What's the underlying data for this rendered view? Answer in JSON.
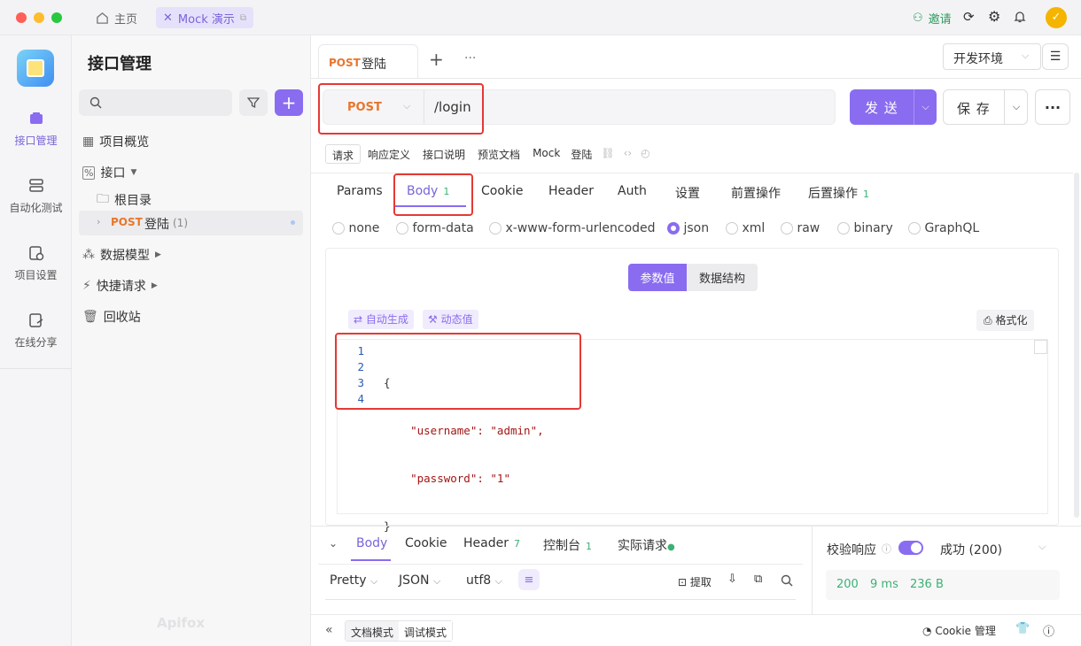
{
  "titlebar": {
    "home_label": "主页",
    "tab_label": "Mock 演示",
    "invite_label": "邀请"
  },
  "leftnav": [
    {
      "label": "接口管理",
      "icon": "api-icon",
      "active": true
    },
    {
      "label": "自动化测试",
      "icon": "automation-icon"
    },
    {
      "label": "项目设置",
      "icon": "settings-icon"
    },
    {
      "label": "在线分享",
      "icon": "share-icon"
    }
  ],
  "sidebar": {
    "title": "接口管理",
    "overview": "项目概览",
    "interfaces": "接口",
    "root": "根目录",
    "item_method": "POST",
    "item_name": "登陆",
    "item_count": "(1)",
    "models": "数据模型",
    "quick": "快捷请求",
    "trash": "回收站"
  },
  "tabs": {
    "active_method": "POST",
    "active_name": "登陆",
    "add": "+",
    "more": "···"
  },
  "env": {
    "label": "开发环境"
  },
  "request": {
    "method": "POST",
    "url": "/login",
    "send": "发 送",
    "save": "保 存"
  },
  "doc_tabs": [
    "请求",
    "响应定义",
    "接口说明",
    "预览文档",
    "Mock"
  ],
  "doc_name": "登陆",
  "param_tabs": [
    {
      "label": "Params"
    },
    {
      "label": "Body",
      "badge": "1"
    },
    {
      "label": "Cookie"
    },
    {
      "label": "Header"
    },
    {
      "label": "Auth"
    },
    {
      "label": "设置"
    },
    {
      "label": "前置操作"
    },
    {
      "label": "后置操作",
      "badge": "1"
    }
  ],
  "body_types": [
    "none",
    "form-data",
    "x-www-form-urlencoded",
    "json",
    "xml",
    "raw",
    "binary",
    "GraphQL"
  ],
  "body_selected": "json",
  "toggle": {
    "values": "参数值",
    "schema": "数据结构"
  },
  "editor": {
    "auto": "自动生成",
    "dynamic": "动态值",
    "format": "格式化",
    "lines": [
      "1",
      "2",
      "3",
      "4"
    ],
    "code": [
      "{",
      "    \"username\": \"admin\",",
      "    \"password\": \"1\"",
      "}"
    ]
  },
  "response": {
    "tabs": [
      {
        "label": "Body"
      },
      {
        "label": "Cookie"
      },
      {
        "label": "Header",
        "badge": "7"
      },
      {
        "label": "控制台",
        "badge": "1"
      },
      {
        "label": "实际请求"
      }
    ],
    "pretty": "Pretty",
    "json": "JSON",
    "encoding": "utf8",
    "extract": "提取"
  },
  "validate": {
    "label": "校验响应",
    "status": "成功 (200)",
    "code": "200",
    "time": "9 ms",
    "size": "236 B"
  },
  "footer": {
    "doc_mode": "文档模式",
    "debug_mode": "调试模式",
    "cookie": "Cookie 管理",
    "watermark": "Apifox"
  },
  "colors": {
    "accent": "#8a6cf0",
    "post": "#e8762c",
    "green": "#3bb273",
    "red": "#e53935"
  }
}
